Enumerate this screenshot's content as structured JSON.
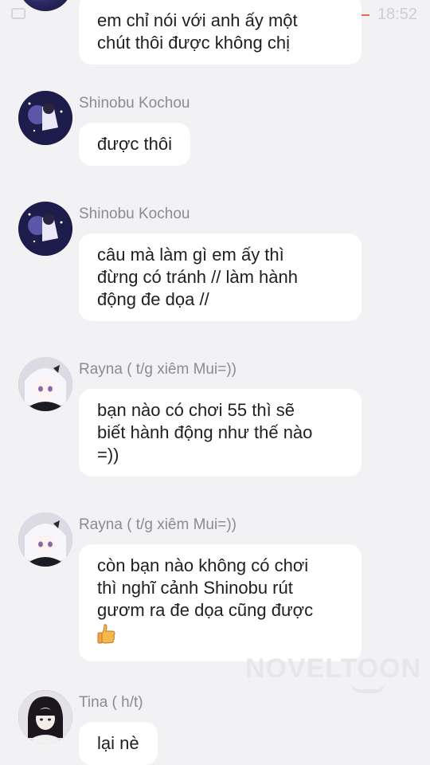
{
  "status_bar": {
    "time": "18:52"
  },
  "messages": [
    {
      "name": "",
      "lines": [
        "em chỉ nói với anh ấy một",
        "chút thôi được không chị"
      ]
    },
    {
      "name": "Shinobu Kochou",
      "lines": [
        "được thôi"
      ]
    },
    {
      "name": "Shinobu Kochou",
      "lines": [
        "câu mà làm gì em ấy thì",
        "đừng có tránh // làm hành",
        "động đe dọa //"
      ]
    },
    {
      "name": "Rayna ( t/g xiêm Mui=))",
      "lines": [
        "bạn nào có chơi 55 thì sẽ",
        "biết hành động như thế nào",
        "=))"
      ]
    },
    {
      "name": "Rayna ( t/g xiêm Mui=))",
      "lines": [
        "còn bạn nào không có chơi",
        "thì nghĩ cảnh Shinobu rút",
        "gươm ra đe dọa cũng được"
      ],
      "emoji": "thumbs-up-icon"
    },
    {
      "name": "Tina ( h/t)",
      "lines": [
        "lại nè"
      ]
    }
  ],
  "watermark": "NOVELTOON"
}
